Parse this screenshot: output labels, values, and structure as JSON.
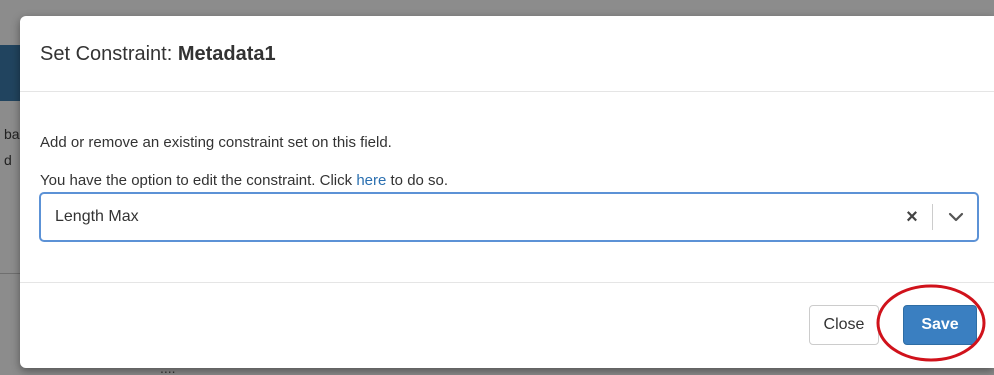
{
  "background": {
    "side_text_1": "ba",
    "side_text_2": "d",
    "bottom_text": "...."
  },
  "dialog": {
    "title_prefix": "Set Constraint: ",
    "title_entity": "Metadata1",
    "body": {
      "line1": "Add or remove an existing constraint set on this field.",
      "line2_before": "You have the option to edit the constraint. Click ",
      "line2_link": "here",
      "line2_after": " to do so."
    },
    "select": {
      "value": "Length Max",
      "clear_glyph": "×"
    },
    "footer": {
      "close_label": "Close",
      "save_label": "Save"
    }
  },
  "colors": {
    "primary": "#3a7fc1",
    "link": "#2a6fb0",
    "focus_border": "#5c92d6",
    "annotation": "#d0121b"
  },
  "icons": {
    "clear": "close-icon",
    "toggle": "chevron-down-icon"
  }
}
